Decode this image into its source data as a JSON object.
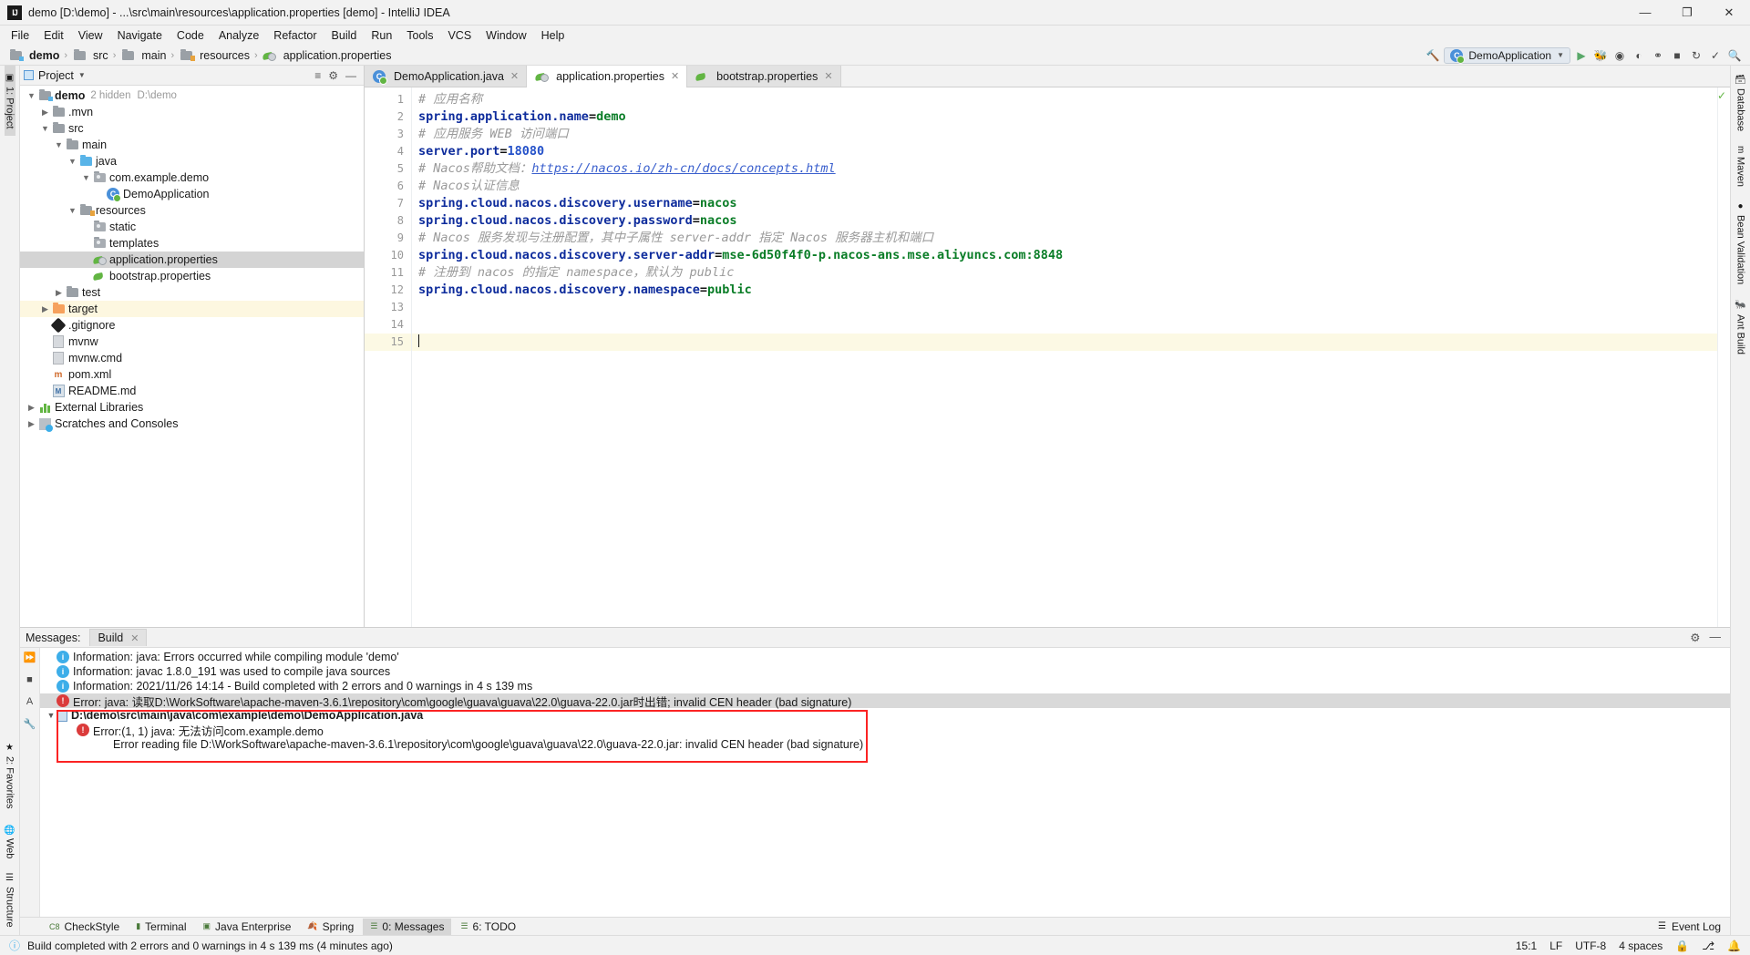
{
  "window": {
    "title": "demo [D:\\demo] - ...\\src\\main\\resources\\application.properties [demo] - IntelliJ IDEA",
    "logo": "IJ",
    "minimize": "—",
    "maximize": "❐",
    "close": "✕"
  },
  "menu": [
    "File",
    "Edit",
    "View",
    "Navigate",
    "Code",
    "Analyze",
    "Refactor",
    "Build",
    "Run",
    "Tools",
    "VCS",
    "Window",
    "Help"
  ],
  "breadcrumb": [
    {
      "label": "demo",
      "icon": "module-folder-icon",
      "bold": true
    },
    {
      "label": "src",
      "icon": "folder-icon",
      "bold": false
    },
    {
      "label": "main",
      "icon": "folder-icon",
      "bold": false
    },
    {
      "label": "resources",
      "icon": "resources-folder-icon",
      "bold": false
    },
    {
      "label": "application.properties",
      "icon": "properties-file-icon",
      "bold": false
    }
  ],
  "toolbar": {
    "build_icon": "hammer-icon",
    "run_config": "DemoApplication",
    "run_icon": "run-icon",
    "debug_icon": "debug-icon",
    "run_with_coverage_icon": "coverage-icon",
    "profile_icon": "profile-icon",
    "attach_icon": "attach-icon",
    "stop_icon": "stop-icon",
    "update_icon": "update-project-icon",
    "commit_icon": "commit-icon",
    "search_icon": "search-everywhere-icon"
  },
  "left_rail": [
    {
      "label": "1: Project",
      "active": true
    }
  ],
  "right_rail": [
    {
      "label": "Database"
    },
    {
      "label": "Maven"
    },
    {
      "label": "Bean Validation"
    },
    {
      "label": "Ant Build"
    }
  ],
  "project_panel": {
    "title": "Project",
    "dropdown_icon": "chevron-down-icon",
    "actions": [
      "collapse-all-icon",
      "settings-gear-icon",
      "hide-icon"
    ],
    "tree": [
      {
        "depth": 0,
        "arrow": "down",
        "icon": "module-folder-icon",
        "label": "demo",
        "bold": true,
        "meta": "2 hidden",
        "meta2": "D:\\demo",
        "state": ""
      },
      {
        "depth": 1,
        "arrow": "right",
        "icon": "folder-icon",
        "label": ".mvn",
        "state": ""
      },
      {
        "depth": 1,
        "arrow": "down",
        "icon": "folder-icon",
        "label": "src",
        "state": ""
      },
      {
        "depth": 2,
        "arrow": "down",
        "icon": "folder-icon",
        "label": "main",
        "state": ""
      },
      {
        "depth": 3,
        "arrow": "down",
        "icon": "source-folder-icon",
        "label": "java",
        "state": ""
      },
      {
        "depth": 4,
        "arrow": "down",
        "icon": "package-icon",
        "label": "com.example.demo",
        "state": ""
      },
      {
        "depth": 5,
        "arrow": "none",
        "icon": "java-class-icon",
        "label": "DemoApplication",
        "state": ""
      },
      {
        "depth": 3,
        "arrow": "down",
        "icon": "resources-folder-icon",
        "label": "resources",
        "state": ""
      },
      {
        "depth": 4,
        "arrow": "none",
        "icon": "package-icon",
        "label": "static",
        "state": ""
      },
      {
        "depth": 4,
        "arrow": "none",
        "icon": "package-icon",
        "label": "templates",
        "state": ""
      },
      {
        "depth": 4,
        "arrow": "none",
        "icon": "spring-properties-icon",
        "label": "application.properties",
        "state": "selected"
      },
      {
        "depth": 4,
        "arrow": "none",
        "icon": "properties-file-icon",
        "label": "bootstrap.properties",
        "state": ""
      },
      {
        "depth": 2,
        "arrow": "right",
        "icon": "folder-icon",
        "label": "test",
        "state": ""
      },
      {
        "depth": 1,
        "arrow": "right",
        "icon": "excluded-folder-icon",
        "label": "target",
        "state": "highlight"
      },
      {
        "depth": 1,
        "arrow": "none",
        "icon": "gitignore-icon",
        "label": ".gitignore",
        "state": ""
      },
      {
        "depth": 1,
        "arrow": "none",
        "icon": "file-icon",
        "label": "mvnw",
        "state": ""
      },
      {
        "depth": 1,
        "arrow": "none",
        "icon": "file-icon",
        "label": "mvnw.cmd",
        "state": ""
      },
      {
        "depth": 1,
        "arrow": "none",
        "icon": "maven-xml-icon",
        "label": "pom.xml",
        "state": ""
      },
      {
        "depth": 1,
        "arrow": "none",
        "icon": "markdown-icon",
        "label": "README.md",
        "state": ""
      },
      {
        "depth": 0,
        "arrow": "right",
        "icon": "libraries-icon",
        "label": "External Libraries",
        "state": ""
      },
      {
        "depth": 0,
        "arrow": "right",
        "icon": "scratches-icon",
        "label": "Scratches and Consoles",
        "state": ""
      }
    ]
  },
  "editor": {
    "tabs": [
      {
        "label": "DemoApplication.java",
        "icon": "java-class-icon",
        "active": false,
        "close": "✕"
      },
      {
        "label": "application.properties",
        "icon": "spring-properties-icon",
        "active": true,
        "close": "✕"
      },
      {
        "label": "bootstrap.properties",
        "icon": "properties-file-icon",
        "active": false,
        "close": "✕"
      }
    ],
    "inspection_ok_icon": "✓",
    "line_numbers": [
      1,
      2,
      3,
      4,
      5,
      6,
      7,
      8,
      9,
      10,
      11,
      12,
      13,
      14,
      15
    ],
    "current_line": 15,
    "lines": [
      {
        "n": 1,
        "type": "comment",
        "text": "# 应用名称"
      },
      {
        "n": 2,
        "type": "prop",
        "key": "spring.application.name",
        "value": "demo",
        "value_kind": "string"
      },
      {
        "n": 3,
        "type": "comment",
        "text": "# 应用服务 WEB 访问端口"
      },
      {
        "n": 4,
        "type": "prop",
        "key": "server.port",
        "value": "18080",
        "value_kind": "number"
      },
      {
        "n": 5,
        "type": "comment-link",
        "text": "# Nacos帮助文档：",
        "link": "https://nacos.io/zh-cn/docs/concepts.html"
      },
      {
        "n": 6,
        "type": "comment",
        "text": "# Nacos认证信息"
      },
      {
        "n": 7,
        "type": "prop",
        "key": "spring.cloud.nacos.discovery.username",
        "value": "nacos",
        "value_kind": "string"
      },
      {
        "n": 8,
        "type": "prop",
        "key": "spring.cloud.nacos.discovery.password",
        "value": "nacos",
        "value_kind": "string"
      },
      {
        "n": 9,
        "type": "comment",
        "text": "# Nacos 服务发现与注册配置，其中子属性 server-addr 指定 Nacos 服务器主机和端口"
      },
      {
        "n": 10,
        "type": "prop",
        "key": "spring.cloud.nacos.discovery.server-addr",
        "value": "mse-6d50f4f0-p.nacos-ans.mse.aliyuncs.com:8848",
        "value_kind": "string"
      },
      {
        "n": 11,
        "type": "comment",
        "text": "# 注册到 nacos 的指定 namespace，默认为 public"
      },
      {
        "n": 12,
        "type": "prop",
        "key": "spring.cloud.nacos.discovery.namespace",
        "value": "public",
        "value_kind": "string"
      },
      {
        "n": 13,
        "type": "blank",
        "text": ""
      },
      {
        "n": 14,
        "type": "blank",
        "text": ""
      },
      {
        "n": 15,
        "type": "caret",
        "text": ""
      }
    ]
  },
  "bottom_panel": {
    "title": "Messages:",
    "tab": "Build",
    "tab_close": "✕",
    "actions": [
      "settings-gear-icon",
      "hide-icon"
    ],
    "rail_icons": [
      "expand-icon",
      "collapse-icon",
      "soft-wrap-icon",
      "settings-icon"
    ],
    "messages": [
      {
        "indent": 0,
        "arrow": "none",
        "icon": "info-icon",
        "text": "Information: java: Errors occurred while compiling module 'demo'",
        "bold": false,
        "selected": false
      },
      {
        "indent": 0,
        "arrow": "none",
        "icon": "info-icon",
        "text": "Information: javac 1.8.0_191 was used to compile java sources",
        "bold": false,
        "selected": false
      },
      {
        "indent": 0,
        "arrow": "none",
        "icon": "info-icon",
        "text": "Information: 2021/11/26 14:14 - Build completed with 2 errors and 0 warnings in 4 s 139 ms",
        "bold": false,
        "selected": false
      },
      {
        "indent": 0,
        "arrow": "none",
        "icon": "error-icon",
        "text": "Error: java: 读取D:\\WorkSoftware\\apache-maven-3.6.1\\repository\\com\\google\\guava\\guava\\22.0\\guava-22.0.jar时出错; invalid CEN header (bad signature)",
        "bold": false,
        "selected": true
      },
      {
        "indent": 0,
        "arrow": "down",
        "icon": "java-file-icon",
        "text": "D:\\demo\\src\\main\\java\\com\\example\\demo\\DemoApplication.java",
        "bold": true,
        "selected": false
      },
      {
        "indent": 1,
        "arrow": "none",
        "icon": "error-icon",
        "text": "Error:(1, 1)  java: 无法访问com.example.demo",
        "bold": false,
        "selected": false
      },
      {
        "indent": 2,
        "arrow": "none",
        "icon": "none",
        "text": "Error reading file D:\\WorkSoftware\\apache-maven-3.6.1\\repository\\com\\google\\guava\\guava\\22.0\\guava-22.0.jar: invalid CEN header (bad signature)",
        "bold": false,
        "selected": false
      }
    ],
    "highlight_box_color": "#fb2323"
  },
  "bottom_tabs": [
    {
      "label": "CheckStyle",
      "icon": "checkstyle-icon",
      "active": false
    },
    {
      "label": "Terminal",
      "icon": "terminal-icon",
      "active": false
    },
    {
      "label": "Java Enterprise",
      "icon": "java-enterprise-icon",
      "active": false
    },
    {
      "label": "Spring",
      "icon": "spring-icon",
      "active": false
    },
    {
      "label": "0: Messages",
      "icon": "messages-icon",
      "active": true
    },
    {
      "label": "6: TODO",
      "icon": "todo-icon",
      "active": false
    }
  ],
  "event_log": {
    "label": "Event Log",
    "icon": "event-log-icon"
  },
  "statusbar": {
    "message": "Build completed with 2 errors and 0 warnings in 4 s 139 ms (4 minutes ago)",
    "info_icon": "info-icon",
    "caret_position": "15:1",
    "line_separator": "LF",
    "encoding": "UTF-8",
    "indent": "4 spaces",
    "lock_icon": "lock-icon",
    "branch_icon": "git-branch-icon",
    "notification_icon": "bell-icon"
  },
  "left_bottom_rail": [
    {
      "label": "2: Favorites"
    },
    {
      "label": "Web"
    },
    {
      "label": "Structure"
    }
  ]
}
